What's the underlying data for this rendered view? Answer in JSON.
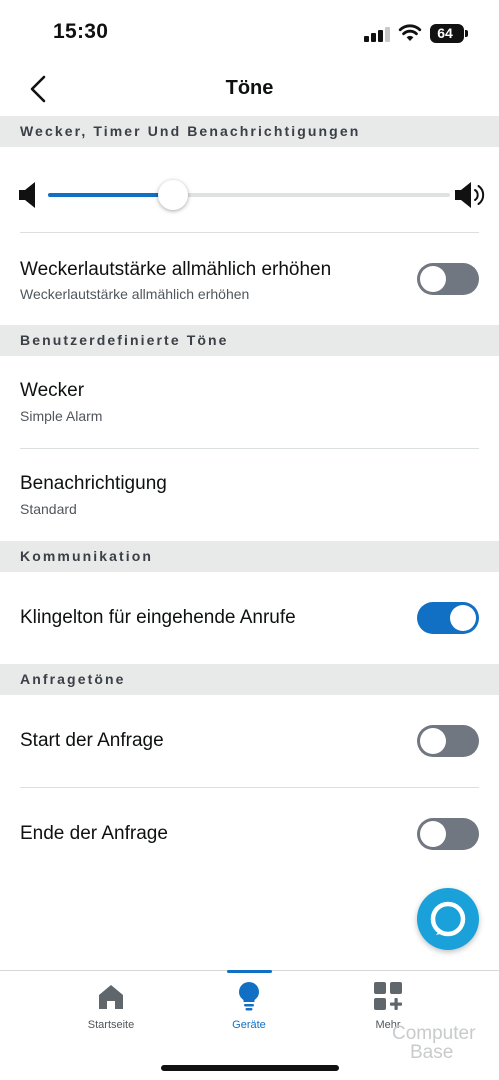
{
  "status_bar": {
    "time": "15:30",
    "battery": "64"
  },
  "header": {
    "title": "Töne",
    "back_icon": "chevron-left-icon"
  },
  "sections": [
    {
      "label": "Wecker, Timer Und Benachrichtigungen"
    },
    {
      "label": "Benutzerdefinierte Töne"
    },
    {
      "label": "Kommunikation"
    },
    {
      "label": "Anfragetöne"
    }
  ],
  "volume_slider": {
    "value_percent": 31,
    "low_icon": "speaker-low-icon",
    "high_icon": "speaker-high-icon",
    "accent": "#1170c4"
  },
  "rows": {
    "gradual_volume": {
      "title": "Weckerlautstärke allmählich erhöhen",
      "subtitle": "Weckerlautstärke allmählich erhöhen",
      "enabled": false
    },
    "alarm": {
      "title": "Wecker",
      "subtitle": "Simple Alarm"
    },
    "notification": {
      "title": "Benachrichtigung",
      "subtitle": "Standard"
    },
    "ringtone": {
      "title": "Klingelton für eingehende Anrufe",
      "enabled": true
    },
    "request_start": {
      "title": "Start der Anfrage",
      "enabled": false
    },
    "request_end": {
      "title": "Ende der Anfrage",
      "enabled": false
    }
  },
  "fab": {
    "icon": "alexa-icon",
    "color": "#1aa1d9"
  },
  "tabbar": {
    "tabs": [
      {
        "label": "Startseite",
        "icon": "home-icon",
        "active": false
      },
      {
        "label": "Geräte",
        "icon": "lightbulb-icon",
        "active": true
      },
      {
        "label": "Mehr",
        "icon": "grid-plus-icon",
        "active": false
      }
    ]
  },
  "watermark": {
    "line1": "Computer",
    "line2": "Base"
  }
}
